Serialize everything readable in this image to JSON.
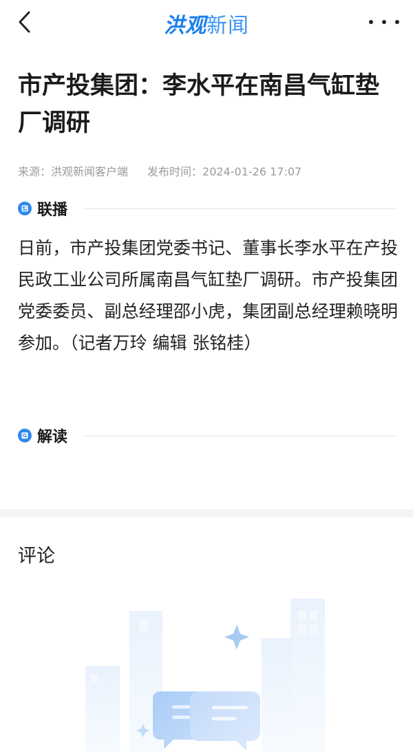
{
  "nav": {
    "logo_part1": "洪观",
    "logo_part2": "新闻",
    "back_icon": "chevron-left-icon",
    "more_icon": "more-horizontal-icon"
  },
  "article": {
    "title": "市产投集团：李水平在南昌气缸垫厂调研",
    "source": "来源：洪观新闻客户端",
    "publish_time": "发布时间：2024-01-26 17:07",
    "sections": {
      "broadcast_label": "联播",
      "broadcast_icon": "newspaper-icon",
      "interpret_label": "解读",
      "interpret_icon": "magnifier-icon"
    },
    "body": "日前，市产投集团党委书记、董事长李水平在产投民政工业公司所属南昌气缸垫厂调研。市产投集团党委委员、副总经理邵小虎，集团副总经理赖晓明参加。（记者万玲 编辑 张铭桂）"
  },
  "comments": {
    "title": "评论",
    "empty_illustration": "empty-comments-illustration-icon"
  },
  "colors": {
    "brand_blue": "#2f88ee",
    "meta_gray": "#9a9a9a",
    "band_gray": "#f4f4f4"
  }
}
